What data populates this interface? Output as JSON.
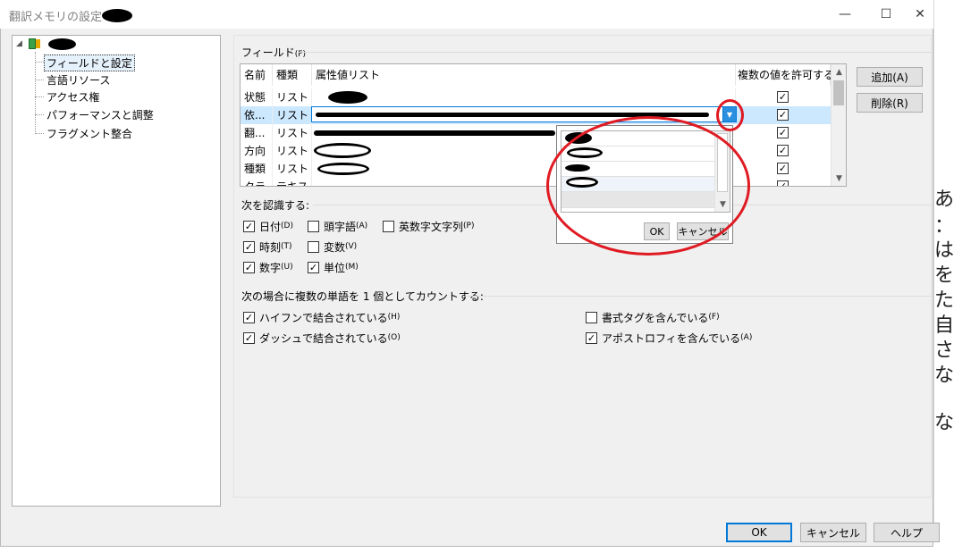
{
  "window": {
    "title": "翻訳メモリの設定 - ",
    "minimize_glyph": "—",
    "maximize_glyph": "☐",
    "close_glyph": "✕"
  },
  "tree": {
    "items": [
      {
        "label": "フィールドと設定",
        "selected": true
      },
      {
        "label": "言語リソース"
      },
      {
        "label": "アクセス権"
      },
      {
        "label": "パフォーマンスと調整"
      },
      {
        "label": "フラグメント整合"
      }
    ]
  },
  "fields": {
    "group_label": "フィールド",
    "group_accel": "(F)",
    "columns": {
      "name": "名前",
      "type": "種類",
      "values": "属性値リスト",
      "multi": "複数の値を許可する"
    },
    "rows": [
      {
        "name": "状態",
        "type": "リスト",
        "multi": true
      },
      {
        "name": "依...",
        "type": "リスト",
        "multi": true,
        "selected": true
      },
      {
        "name": "翻...",
        "type": "リスト",
        "multi": true
      },
      {
        "name": "方向",
        "type": "リスト",
        "multi": true
      },
      {
        "name": "種類",
        "type": "リスト",
        "multi": true
      },
      {
        "name": "クラ",
        "type": "テキスト",
        "multi": true
      }
    ],
    "add_button": "追加(A)",
    "delete_button": "削除(R)"
  },
  "popup": {
    "ok": "OK",
    "cancel": "キャンセル"
  },
  "recognize": {
    "group_label": "次を認識する:",
    "options": [
      {
        "label": "日付",
        "accel": "(D)",
        "checked": true
      },
      {
        "label": "頭字語",
        "accel": "(A)",
        "checked": false
      },
      {
        "label": "英数字文字列",
        "accel": "(P)",
        "checked": false
      },
      {
        "label": "時刻",
        "accel": "(T)",
        "checked": true
      },
      {
        "label": "変数",
        "accel": "(V)",
        "checked": false
      },
      {
        "label": "数字",
        "accel": "(U)",
        "checked": true
      },
      {
        "label": "単位",
        "accel": "(M)",
        "checked": true
      }
    ]
  },
  "count": {
    "group_label": "次の場合に複数の単語を 1 個としてカウントする:",
    "options": [
      {
        "label": "ハイフンで結合されている",
        "accel": "(H)",
        "checked": true
      },
      {
        "label": "ダッシュで結合されている",
        "accel": "(O)",
        "checked": true
      },
      {
        "label": "書式タグを含んでいる",
        "accel": "(F)",
        "checked": false
      },
      {
        "label": "アポストロフィを含んでいる",
        "accel": "(A)",
        "checked": true
      }
    ]
  },
  "footer": {
    "ok": "OK",
    "cancel": "キャンセル",
    "help": "ヘルプ"
  },
  "colors": {
    "annotation": "#e01a22",
    "selection": "#cce8ff",
    "accent": "#0078d7"
  },
  "background_glyphs": [
    "あ",
    "：",
    "は",
    "を",
    "た",
    "自",
    "さ",
    "な",
    "な"
  ]
}
